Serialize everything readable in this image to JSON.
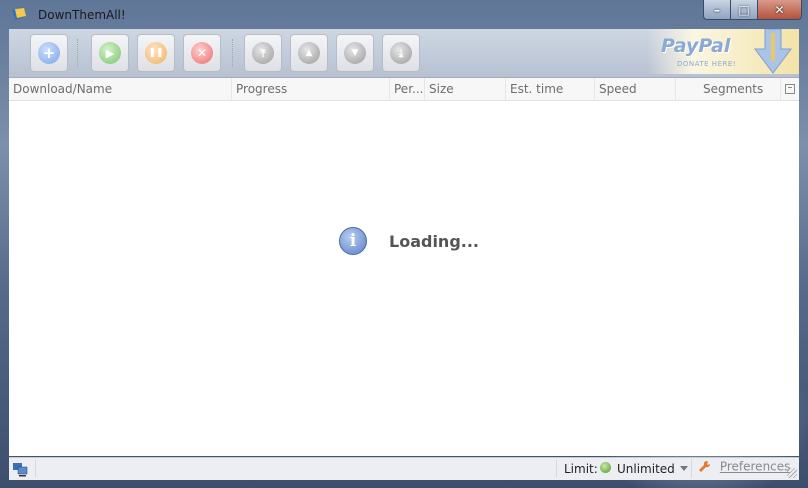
{
  "window": {
    "title": "DownThemAll!"
  },
  "toolbar": {
    "buttons": [
      {
        "name": "add-download-button",
        "icon": "plus-icon",
        "glyph": "+"
      },
      {
        "name": "resume-button",
        "icon": "play-icon",
        "glyph": "▶"
      },
      {
        "name": "pause-button",
        "icon": "pause-icon",
        "glyph": "❚❚"
      },
      {
        "name": "cancel-button",
        "icon": "cancel-icon",
        "glyph": "✕"
      },
      {
        "name": "move-top-button",
        "icon": "move-top-icon",
        "glyph": "⤒"
      },
      {
        "name": "move-up-button",
        "icon": "move-up-icon",
        "glyph": "▲"
      },
      {
        "name": "move-down-button",
        "icon": "move-down-icon",
        "glyph": "▼"
      },
      {
        "name": "move-bottom-button",
        "icon": "move-bottom-icon",
        "glyph": "⤓"
      }
    ],
    "donate": {
      "brand": "PayPal",
      "caption": "DONATE HERE!"
    }
  },
  "columns": [
    "Download/Name",
    "Progress",
    "Per...",
    "Size",
    "Est. time",
    "Speed",
    "Segments"
  ],
  "content": {
    "loading_text": "Loading...",
    "info_glyph": "i"
  },
  "statusbar": {
    "limit_label": "Limit:",
    "limit_value": "Unlimited",
    "preferences_label": "Preferences"
  },
  "colors": {
    "accent": "#5a7fc6",
    "content_bg": "#ffffff",
    "status_ok": "#4e9a2e"
  }
}
